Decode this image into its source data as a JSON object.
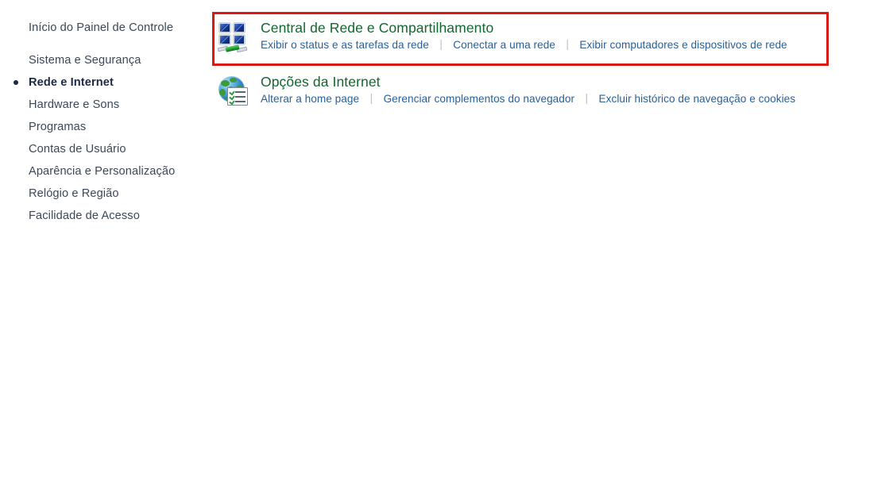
{
  "page": {
    "title": "Painel de Controle - Rede e Internet"
  },
  "sidebar": {
    "home_label": "Início do Painel de Controle",
    "items": [
      {
        "label": "Sistema e Segurança",
        "selected": false
      },
      {
        "label": "Rede e Internet",
        "selected": true
      },
      {
        "label": "Hardware e Sons",
        "selected": false
      },
      {
        "label": "Programas",
        "selected": false
      },
      {
        "label": "Contas de Usuário",
        "selected": false
      },
      {
        "label": "Aparência e Personalização",
        "selected": false
      },
      {
        "label": "Relógio e Região",
        "selected": false
      },
      {
        "label": "Facilidade de Acesso",
        "selected": false
      }
    ]
  },
  "main": {
    "categories": [
      {
        "icon": "network-sharing-icon",
        "title": "Central de Rede e Compartilhamento",
        "links": [
          "Exibir o status e as tarefas da rede",
          "Conectar a uma rede",
          "Exibir computadores e dispositivos de rede"
        ]
      },
      {
        "icon": "internet-options-globe-icon",
        "title": "Opções da Internet",
        "links": [
          "Alterar a home page",
          "Gerenciar complementos do navegador",
          "Excluir histórico de navegação e cookies"
        ]
      }
    ]
  },
  "highlight": {
    "name": "network-sharing-center-highlight",
    "color": "#d91a14",
    "target": "Central de Rede e Compartilhamento"
  },
  "colors": {
    "category_title": "#13662f",
    "link": "#2a6099",
    "sidebar_text": "#3c4858",
    "sidebar_selected_text": "#1b2a47",
    "separator": "#b9bfc6",
    "background": "#ffffff",
    "highlight": "#d91a14"
  }
}
